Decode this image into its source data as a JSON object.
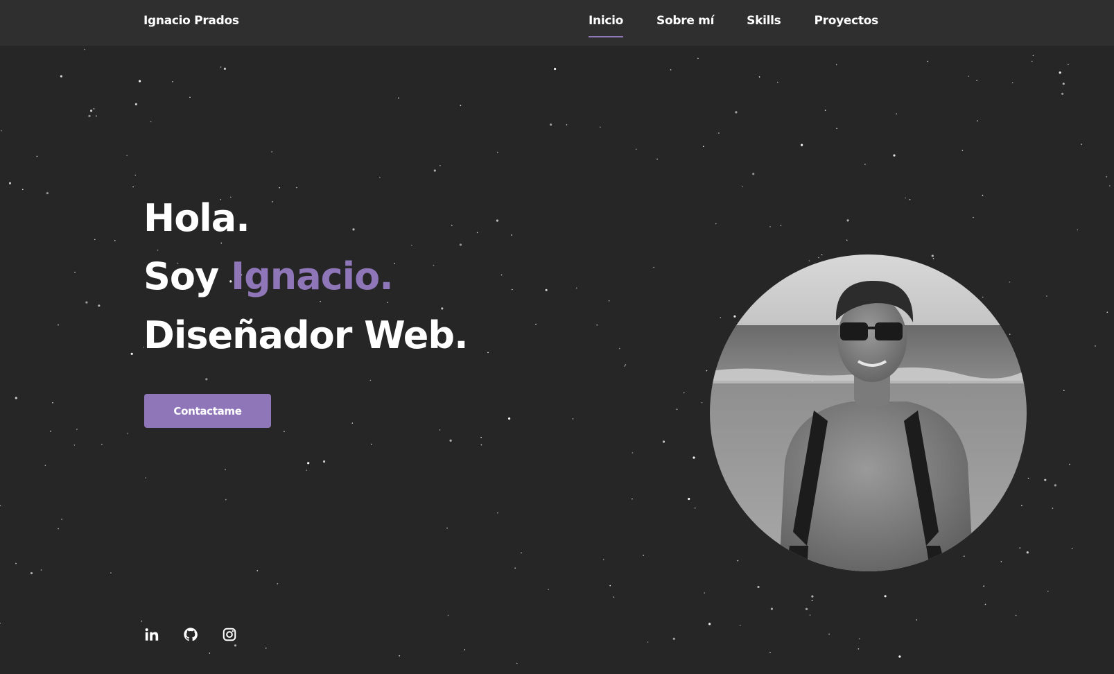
{
  "header": {
    "brand": "Ignacio Prados",
    "nav": [
      {
        "label": "Inicio",
        "active": true
      },
      {
        "label": "Sobre mí",
        "active": false
      },
      {
        "label": "Skills",
        "active": false
      },
      {
        "label": "Proyectos",
        "active": false
      }
    ]
  },
  "hero": {
    "line1": "Hola.",
    "line2_prefix": "Soy ",
    "line2_name": "Ignacio.",
    "line3": "Diseñador Web.",
    "cta_label": "Contactame",
    "photo_alt": "Ignacio Prados"
  },
  "socials": [
    {
      "icon": "linkedin-icon"
    },
    {
      "icon": "github-icon"
    },
    {
      "icon": "instagram-icon"
    }
  ],
  "colors": {
    "background": "#262627",
    "navbar": "#2f2f30",
    "accent": "#8e76b8",
    "text": "#ffffff"
  }
}
